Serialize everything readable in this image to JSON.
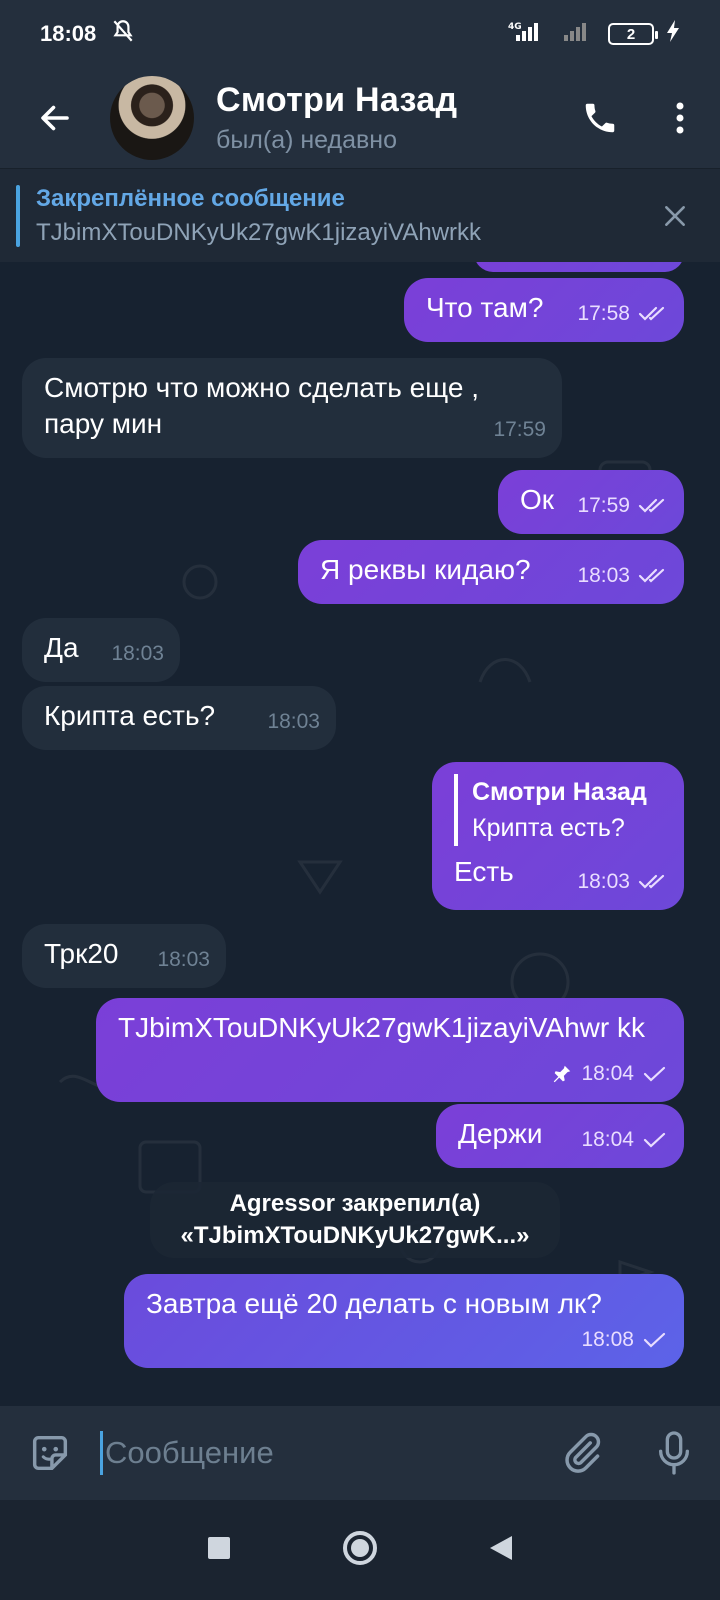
{
  "status_bar": {
    "time": "18:08",
    "battery": "2"
  },
  "header": {
    "name": "Смотри Назад",
    "status": "был(а) недавно"
  },
  "pinned": {
    "title": "Закреплённое сообщение",
    "text": "TJbimXTouDNKyUk27gwK1jizayiVAhwrkk"
  },
  "messages": [
    {
      "dir": "out",
      "text": "Что там?",
      "time": "17:58",
      "ticks": "double"
    },
    {
      "dir": "in",
      "text": "Смотрю что можно сделать еще , пару мин",
      "time": "17:59"
    },
    {
      "dir": "out",
      "text": "Ок",
      "time": "17:59",
      "ticks": "double"
    },
    {
      "dir": "out",
      "text": "Я реквы кидаю?",
      "time": "18:03",
      "ticks": "double"
    },
    {
      "dir": "in",
      "text": "Да",
      "time": "18:03"
    },
    {
      "dir": "in",
      "text": "Крипта есть?",
      "time": "18:03"
    },
    {
      "dir": "out",
      "reply_name": "Смотри Назад",
      "reply_text": "Крипта есть?",
      "text": "Есть",
      "time": "18:03",
      "ticks": "double"
    },
    {
      "dir": "in",
      "text": "Трк20",
      "time": "18:03"
    },
    {
      "dir": "out",
      "text": "TJbimXTouDNKyUk27gwK1jizayiVAhwr kk",
      "time": "18:04",
      "ticks": "single",
      "pinned": true
    },
    {
      "dir": "out",
      "text": "Держи",
      "time": "18:04",
      "ticks": "single"
    },
    {
      "dir": "out",
      "text": "Завтра ещё 20 делать с новым лк?",
      "time": "18:08",
      "ticks": "single"
    }
  ],
  "service": {
    "line1": "Agressor закрепил(а)",
    "line2": "«TJbimXTouDNKyUk27gwK...»"
  },
  "input": {
    "placeholder": "Сообщение"
  },
  "icons": {
    "back": "arrow-left-icon",
    "call": "phone-icon",
    "menu": "more-vert-icon",
    "close": "close-icon",
    "emoji": "sticker-icon",
    "attach": "paperclip-icon",
    "mic": "microphone-icon"
  },
  "colors": {
    "out_bubble": "#7b3fd8",
    "in_bubble": "#222e3c",
    "accent": "#4aa3e0"
  }
}
